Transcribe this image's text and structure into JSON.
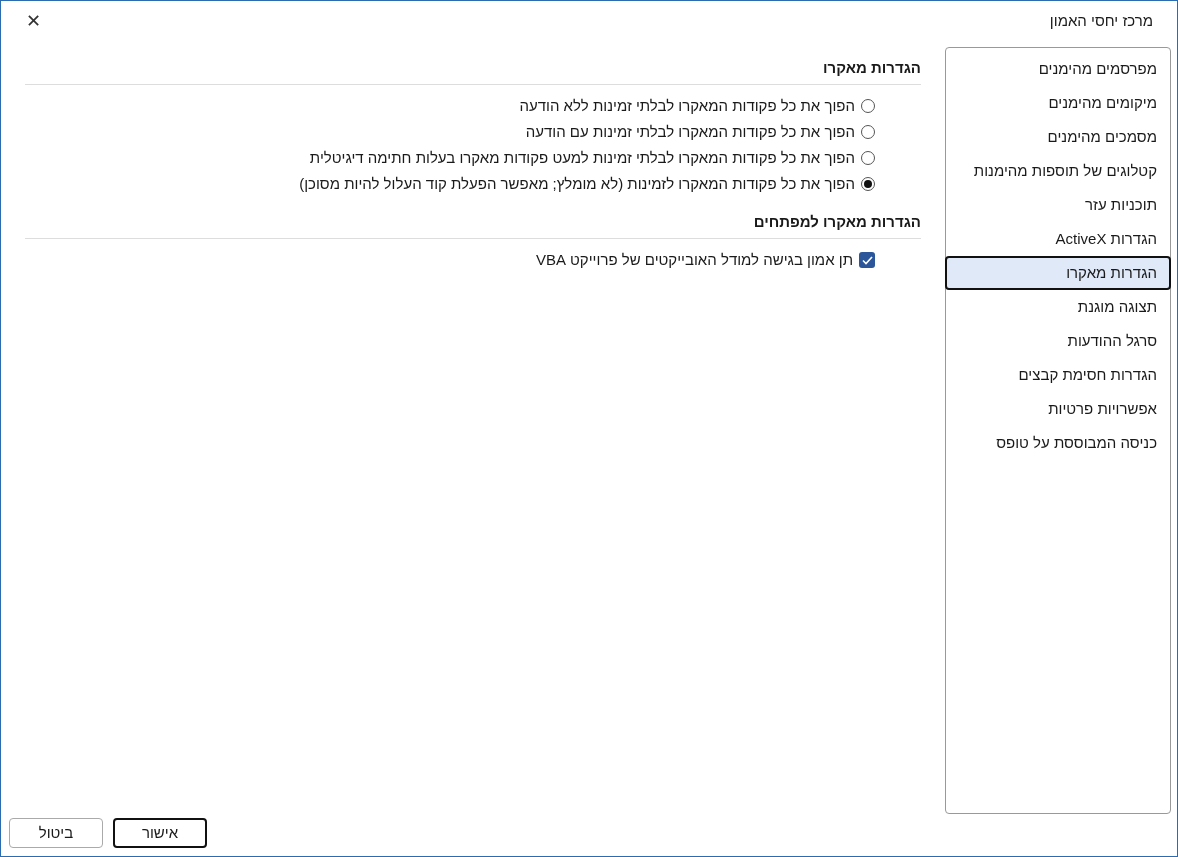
{
  "window": {
    "title": "מרכז יחסי האמון",
    "close": "✕"
  },
  "sidebar": {
    "items": [
      {
        "label": "מפרסמים מהימנים",
        "selected": false
      },
      {
        "label": "מיקומים מהימנים",
        "selected": false
      },
      {
        "label": "מסמכים מהימנים",
        "selected": false
      },
      {
        "label": "קטלוגים של תוספות מהימנות",
        "selected": false
      },
      {
        "label": "תוכניות עזר",
        "selected": false
      },
      {
        "label": "הגדרות ActiveX",
        "selected": false
      },
      {
        "label": "הגדרות מאקרו",
        "selected": true
      },
      {
        "label": "תצוגה מוגנת",
        "selected": false
      },
      {
        "label": "סרגל ההודעות",
        "selected": false
      },
      {
        "label": "הגדרות חסימת קבצים",
        "selected": false
      },
      {
        "label": "אפשרויות פרטיות",
        "selected": false
      },
      {
        "label": "כניסה המבוססת על טופס",
        "selected": false
      }
    ]
  },
  "sections": [
    {
      "heading": "הגדרות מאקרו",
      "options": [
        {
          "kind": "radio",
          "label": "הפוך את כל פקודות המאקרו לבלתי זמינות ללא הודעה",
          "selected": false
        },
        {
          "kind": "radio",
          "label": "הפוך את כל פקודות המאקרו לבלתי זמינות עם הודעה",
          "selected": false
        },
        {
          "kind": "radio",
          "label": "הפוך את כל פקודות המאקרו לבלתי זמינות למעט פקודות מאקרו בעלות חתימה דיגיטלית",
          "selected": false
        },
        {
          "kind": "radio",
          "label": "הפוך את כל פקודות המאקרו לזמינות (לא מומלץ; מאפשר הפעלת קוד העלול להיות מסוכן)",
          "selected": true
        }
      ]
    },
    {
      "heading": "הגדרות מאקרו למפתחים",
      "options": [
        {
          "kind": "checkbox",
          "label": "תן אמון בגישה למודל האובייקטים של פרוייקט VBA",
          "checked": true
        }
      ]
    }
  ],
  "buttons": [
    {
      "label": "אישור",
      "default": true
    },
    {
      "label": "ביטול",
      "default": false
    }
  ]
}
